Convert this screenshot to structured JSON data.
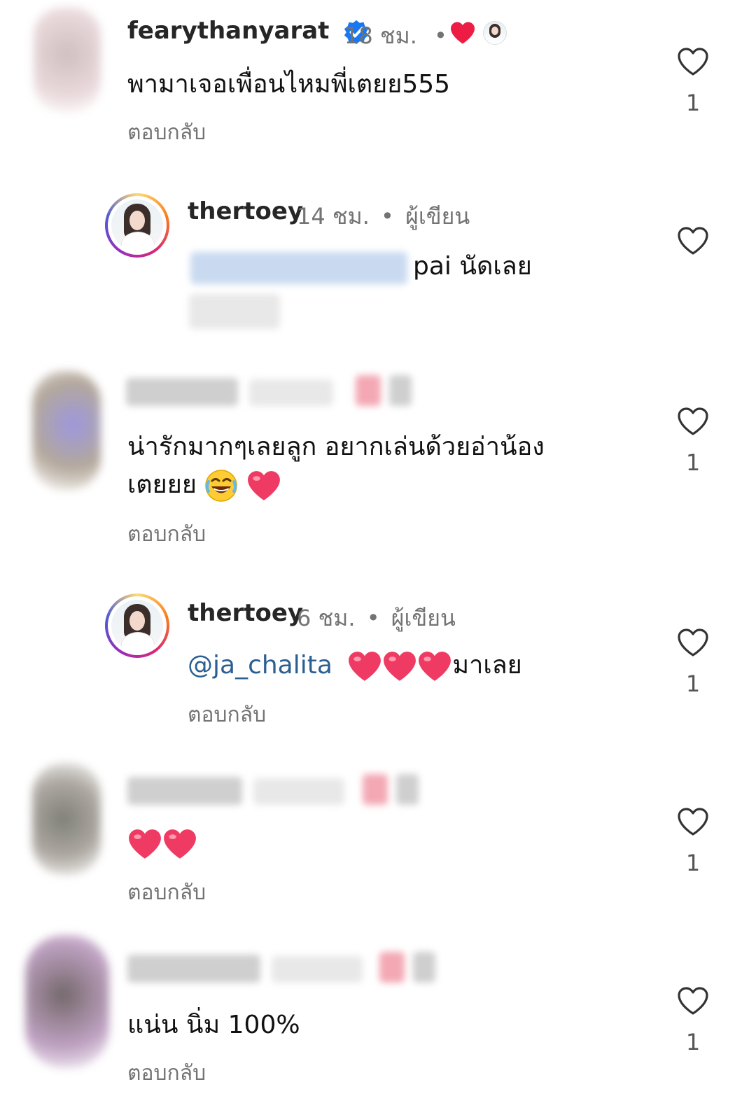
{
  "colors": {
    "like_heart": "#ed1c45",
    "mention": "#2b5f92",
    "meta_text": "#737373",
    "verified_badge": "#1877f2"
  },
  "comments": [
    {
      "username": "fearythanyarat",
      "verified": true,
      "time": "18 ชม.",
      "text": "พามาเจอเพื่อนไหมพี่เตยย555",
      "reply_label": "ตอบกลับ",
      "like_count": "1"
    },
    {
      "username": "thertoey",
      "time": "14 ชม.",
      "role": "ผู้เขียน",
      "text": "pai นัดเลย",
      "like_count": ""
    },
    {
      "text_line1": "น่ารักมากๆเลยลูก อยากเล่นด้วยอ่าน้อง",
      "text_line2": "เตยยย",
      "reply_label": "ตอบกลับ",
      "like_count": "1"
    },
    {
      "username": "thertoey",
      "time": "6 ชม.",
      "role": "ผู้เขียน",
      "mention": "@ja_chalita",
      "text": "มาเลย",
      "reply_label": "ตอบกลับ",
      "like_count": "1"
    },
    {
      "reply_label": "ตอบกลับ",
      "like_count": "1"
    },
    {
      "text": "แน่น นิ่ม 100%",
      "reply_label": "ตอบกลับ",
      "like_count": "1"
    }
  ],
  "separator_dot": "•"
}
